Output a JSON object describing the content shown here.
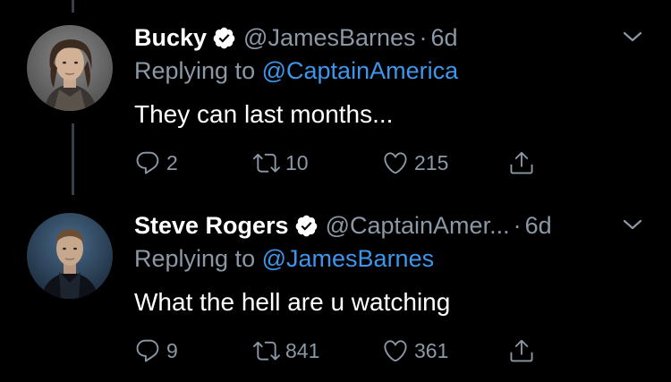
{
  "colors": {
    "background": "#000000",
    "muted": "#8b98a5",
    "link": "#3d96ec",
    "text": "#ffffff",
    "thread_line": "#3a3f45"
  },
  "tweets": [
    {
      "display_name": "Bucky",
      "verified": true,
      "handle": "@JamesBarnes",
      "separator": "·",
      "time": "6d",
      "replying_prefix": "Replying to",
      "replying_to": "@CaptainAmerica",
      "text": "They can last months...",
      "reply_count": "2",
      "retweet_count": "10",
      "like_count": "215",
      "avatar": "avatar-photo"
    },
    {
      "display_name": "Steve Rogers",
      "verified": true,
      "handle": "@CaptainAmer...",
      "separator": "·",
      "time": "6d",
      "replying_prefix": "Replying to",
      "replying_to": "@JamesBarnes",
      "text": "What the hell are u watching",
      "reply_count": "9",
      "retweet_count": "841",
      "like_count": "361",
      "avatar": "avatar-photo"
    }
  ],
  "icons": {
    "reply": "reply-icon",
    "retweet": "retweet-icon",
    "like": "heart-icon",
    "share": "share-icon",
    "more": "chevron-down-icon",
    "verified": "verified-badge-icon"
  }
}
